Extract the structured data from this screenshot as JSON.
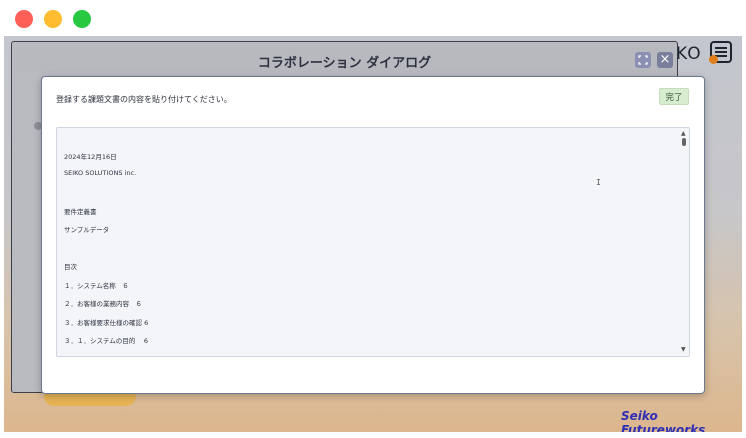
{
  "window": {
    "controls": [
      "close",
      "minimize",
      "maximize"
    ]
  },
  "app": {
    "brand_fragment": "KO",
    "footer_brand": "Seiko Futureworks"
  },
  "collab": {
    "title": "コラボレーション ダイアログ",
    "expand_icon": "expand-icon",
    "close_icon": "×"
  },
  "dialog": {
    "instruction": "登録する課題文書の内容を貼り付けてください。",
    "done_label": "完了",
    "lines": [
      "2024年12月16日",
      "SEIKO SOLUTIONS inc.",
      "",
      "要件定義書",
      "サンプルデータ",
      "",
      "目次",
      "１．システム名称　６",
      "２．お客様の業務内容　６",
      "３．お客様要求仕様の確認 6",
      "３．１．システムの目的　 6"
    ]
  }
}
